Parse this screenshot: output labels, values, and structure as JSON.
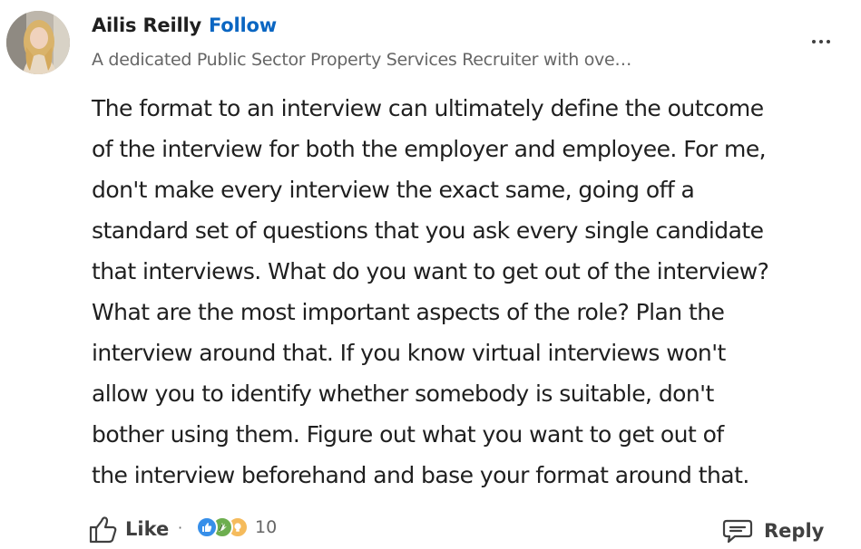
{
  "author": {
    "name": "Ailis Reilly",
    "follow_label": "Follow",
    "headline": "A dedicated Public Sector Property Services Recruiter with ove…"
  },
  "comment": {
    "lines": [
      "The format to an interview can ultimately define the outcome",
      "of the interview for both the employer and employee. For me,",
      "don't make every interview the exact same, going off a",
      "standard set of questions that you ask every single candidate",
      "that interviews. What do you want to get out of the interview?",
      "What are the most important aspects of the role? Plan the",
      "interview around that. If you know virtual interviews won't",
      "allow you to identify whether somebody is suitable, don't",
      "bother using them. Figure out what you want to get out of",
      "the interview beforehand and base your format around that."
    ]
  },
  "actions": {
    "like_label": "Like",
    "separator": "·",
    "reaction_count": "10",
    "reply_label": "Reply",
    "reactions": [
      "like-reaction-icon",
      "celebrate-reaction-icon",
      "insightful-reaction-icon"
    ]
  },
  "colors": {
    "link": "#0a66c2",
    "text": "#1f1f1f",
    "muted": "#666666",
    "like_reaction": "#378fe9",
    "celebrate_reaction": "#44712e",
    "insightful_reaction": "#e7a33e"
  },
  "icons": {
    "more": "ellipsis-icon",
    "like": "thumbs-up-icon",
    "reply": "speech-bubble-icon"
  }
}
